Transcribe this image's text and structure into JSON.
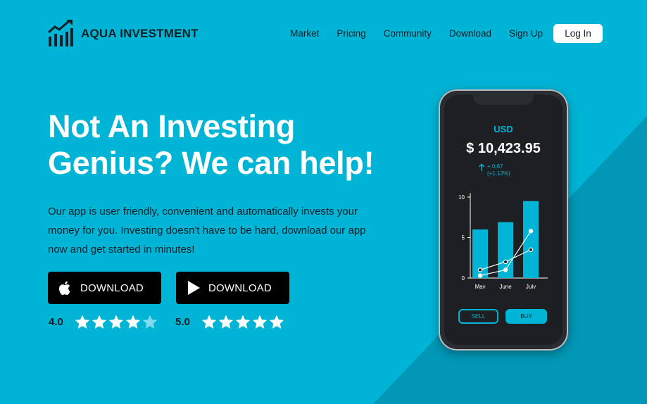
{
  "brand": {
    "name": "AQUA INVESTMENT",
    "icon": "bar-chart-growth-icon"
  },
  "nav": {
    "links": [
      "Market",
      "Pricing",
      "Community",
      "Download",
      "Sign Up"
    ],
    "login_label": "Log In"
  },
  "hero": {
    "title": "Not An Investing Genius? We can help!",
    "description": "Our app is user friendly, convenient and automatically invests your money for you. Investing doesn't have to be hard, download our app now and get started in minutes!"
  },
  "downloads": [
    {
      "icon": "apple-icon",
      "label": "DOWNLOAD",
      "rating_text": "4.0",
      "rating": 4,
      "max": 5
    },
    {
      "icon": "play-icon",
      "label": "DOWNLOAD",
      "rating_text": "5.0",
      "rating": 5,
      "max": 5
    }
  ],
  "phone_app": {
    "currency": "USD",
    "balance": "$ 10,423.95",
    "change_abs": "+ 0.67",
    "change_pct": "(+1,12%)",
    "sell_label": "SELL",
    "buy_label": "BUY"
  },
  "colors": {
    "background": "#00b4d6",
    "background_dark": "#0098b6",
    "accent": "#00b4d6",
    "text_dark": "#0f1f27",
    "button_black": "#000000",
    "phone_screen": "#1d1f22"
  },
  "chart_data": {
    "type": "bar",
    "categories": [
      "May",
      "June",
      "July"
    ],
    "values": [
      6,
      6.9,
      9.5
    ],
    "line_series": [
      {
        "values": [
          0.3,
          1.0,
          5.8
        ]
      },
      {
        "values": [
          1.0,
          2.0,
          3.5
        ]
      }
    ],
    "yticks": [
      "0",
      "5",
      "10"
    ],
    "ylim": [
      0,
      10
    ],
    "grid": false
  }
}
